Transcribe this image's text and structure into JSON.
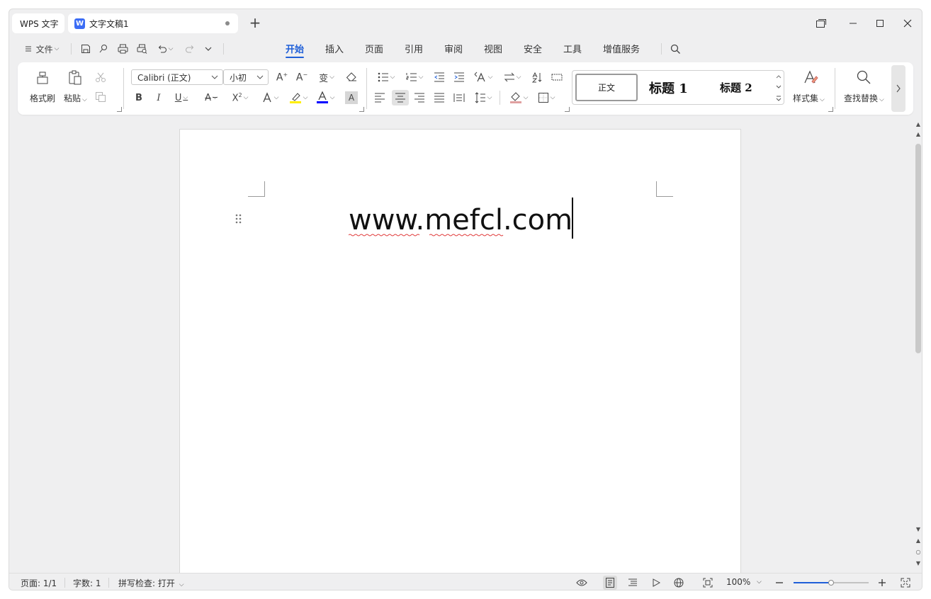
{
  "titlebar": {
    "home_tab": "WPS 文字",
    "doc_tab": "文字文稿1",
    "doc_tab_icon": "W",
    "new_tab": "+"
  },
  "menu": {
    "file_label": "文件",
    "tabs": [
      "开始",
      "插入",
      "页面",
      "引用",
      "审阅",
      "视图",
      "安全",
      "工具",
      "增值服务"
    ],
    "active_tab": "开始"
  },
  "ribbon": {
    "format_painter": "格式刷",
    "paste": "粘贴",
    "font_name": "Calibri (正文)",
    "font_size": "小初",
    "styles": {
      "normal": "正文",
      "heading1": "标题 1",
      "heading2": "标题 2"
    },
    "style_set": "样式集",
    "find_replace": "查找替换"
  },
  "document": {
    "text": "www.mefcl.com"
  },
  "status": {
    "page": "页面: 1/1",
    "words": "字数: 1",
    "spell": "拼写检查: 打开",
    "zoom": "100%",
    "zoom_level": 0.5
  },
  "colors": {
    "accent": "#1f5fd8",
    "highlight": "#ffee00",
    "font_color": "#0000ff",
    "spell_error": "#e03a3a"
  }
}
